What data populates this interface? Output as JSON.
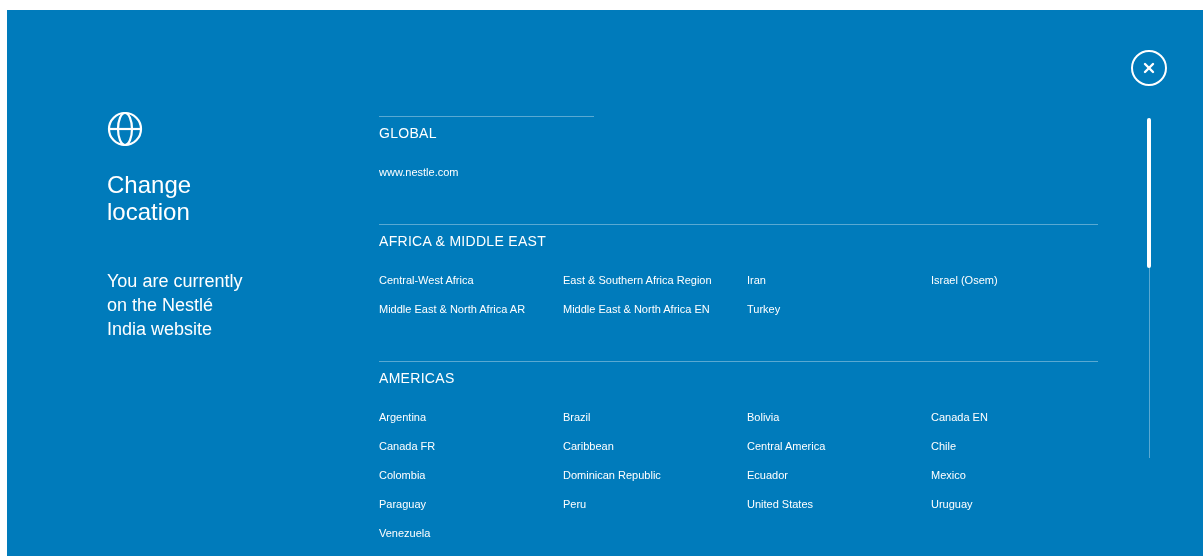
{
  "intro": {
    "title": "Change location",
    "current": "You are currently on the Nestlé India website"
  },
  "sections": [
    {
      "kind": "global",
      "heading": "GLOBAL",
      "links": [
        "www.nestle.com"
      ]
    },
    {
      "kind": "region",
      "heading": "AFRICA & MIDDLE EAST",
      "links": [
        "Central-West Africa",
        "East & Southern Africa Region",
        "Iran",
        "Israel (Osem)",
        "Middle East & North Africa AR",
        "Middle East & North Africa EN",
        "Turkey"
      ]
    },
    {
      "kind": "region",
      "heading": "AMERICAS",
      "links": [
        "Argentina",
        "Brazil",
        "Bolivia",
        "Canada EN",
        "Canada FR",
        "Caribbean",
        "Central America",
        "Chile",
        "Colombia",
        "Dominican Republic",
        "Ecuador",
        "Mexico",
        "Paraguay",
        "Peru",
        "United States",
        "Uruguay",
        "Venezuela"
      ]
    }
  ]
}
